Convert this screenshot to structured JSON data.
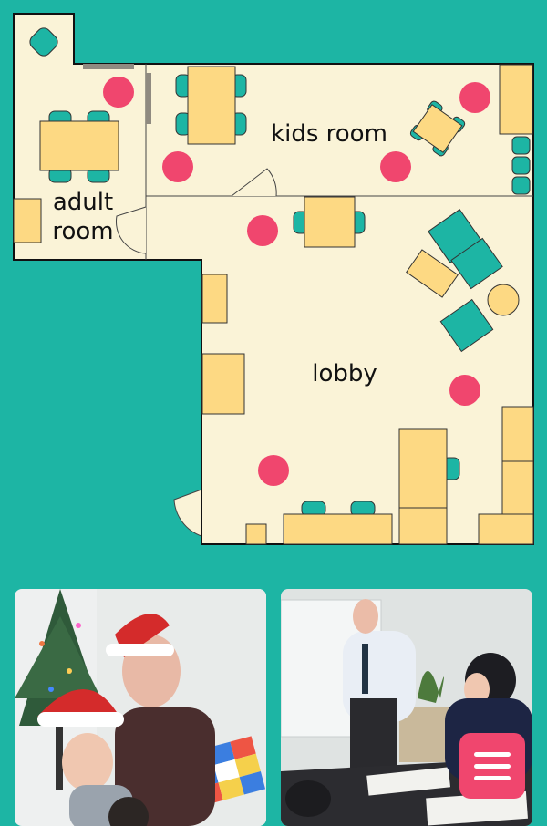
{
  "floorplan": {
    "rooms": {
      "kids": "kids room",
      "adult_line1": "adult",
      "adult_line2": "room",
      "lobby": "lobby"
    },
    "colors": {
      "background": "#1db5a4",
      "floor": "#faf3d7",
      "table": "#fdd983",
      "seat": "#1db5a4",
      "marker": "#f0466e",
      "wall": "#111111"
    }
  },
  "photos": [
    {
      "name": "christmas-lesson-photo"
    },
    {
      "name": "classroom-teacher-photo"
    }
  ],
  "menu": {
    "icon": "hamburger-menu-icon"
  }
}
